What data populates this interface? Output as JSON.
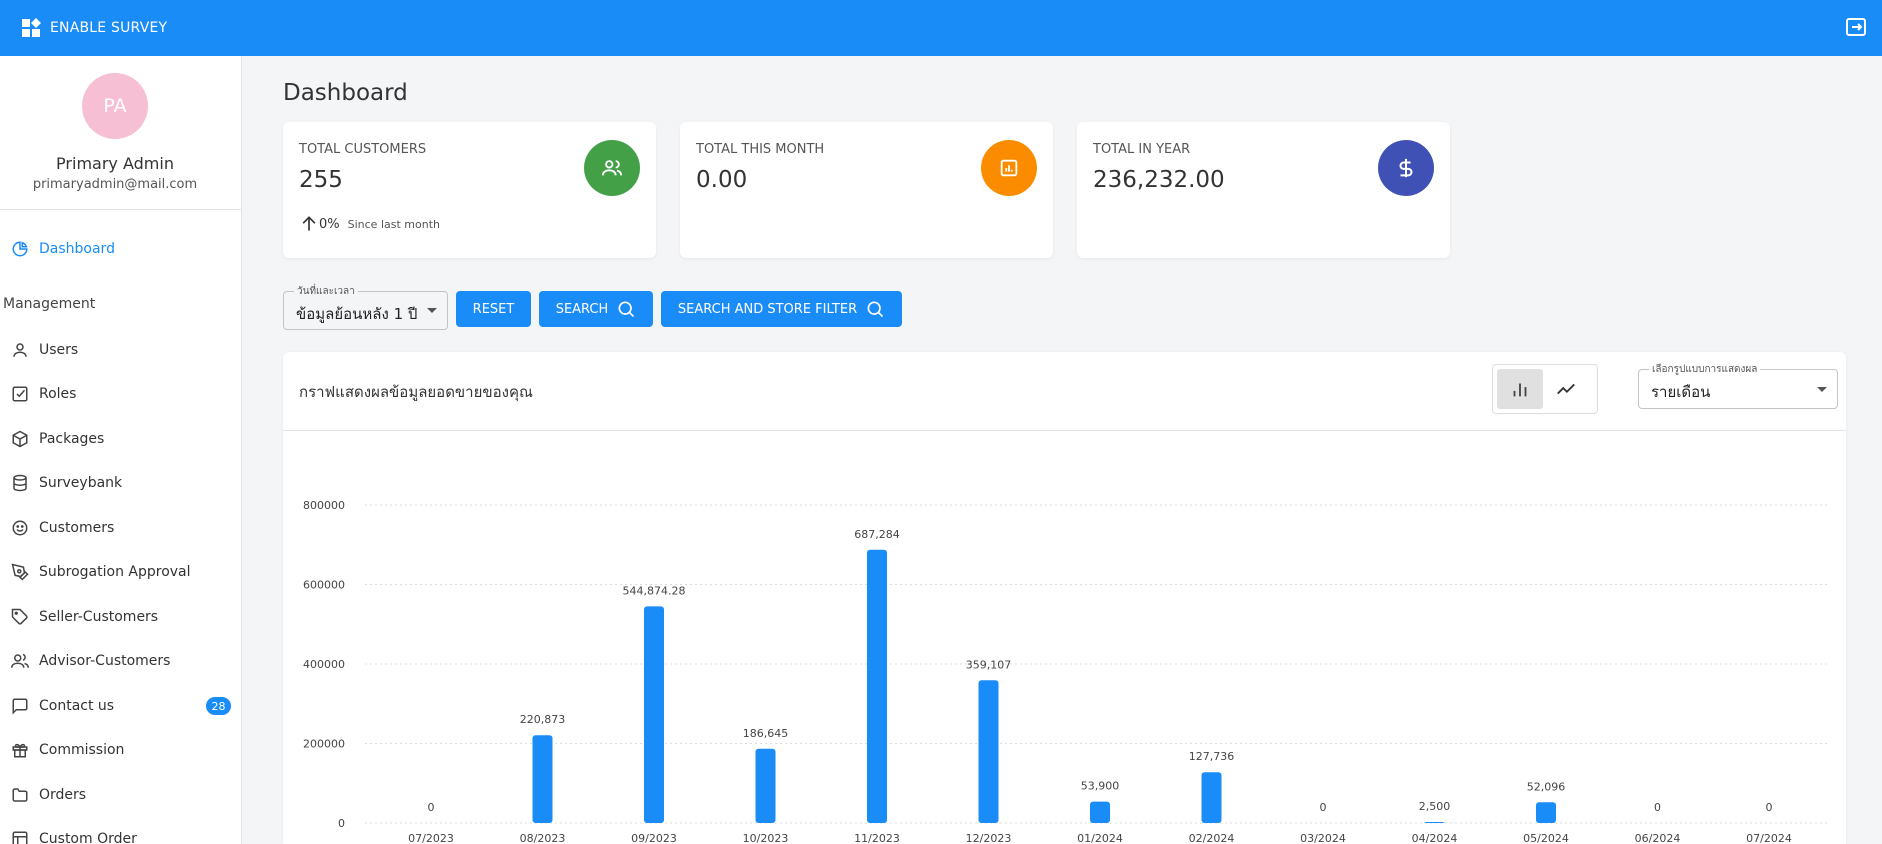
{
  "app": {
    "title": "ENABLE SURVEY"
  },
  "user": {
    "initials": "PA",
    "name": "Primary Admin",
    "email": "primaryadmin@mail.com"
  },
  "sidebar": {
    "dashboard_label": "Dashboard",
    "section_label": "Management",
    "items": [
      {
        "label": "Users",
        "icon": "user-icon"
      },
      {
        "label": "Roles",
        "icon": "checkbox-icon"
      },
      {
        "label": "Packages",
        "icon": "package-icon"
      },
      {
        "label": "Surveybank",
        "icon": "database-icon"
      },
      {
        "label": "Customers",
        "icon": "smile-icon"
      },
      {
        "label": "Subrogation Approval",
        "icon": "pen-icon"
      },
      {
        "label": "Seller-Customers",
        "icon": "tag-icon"
      },
      {
        "label": "Advisor-Customers",
        "icon": "users-icon"
      },
      {
        "label": "Contact us",
        "icon": "message-icon",
        "badge": "28"
      },
      {
        "label": "Commission",
        "icon": "gift-icon"
      },
      {
        "label": "Orders",
        "icon": "folder-icon"
      },
      {
        "label": "Custom Order",
        "icon": "table-icon"
      }
    ]
  },
  "page": {
    "title": "Dashboard"
  },
  "cards": {
    "customers": {
      "label": "TOTAL CUSTOMERS",
      "value": "255",
      "trend_value": "0%",
      "trend_text": "Since last month",
      "color": "#43a047"
    },
    "month": {
      "label": "TOTAL THIS MONTH",
      "value": "0.00",
      "color": "#fb8c00"
    },
    "year": {
      "label": "TOTAL IN YEAR",
      "value": "236,232.00",
      "color": "#3f51b5"
    }
  },
  "filters": {
    "date_legend": "วันที่และเวลา",
    "date_value": "ข้อมูลย้อนหลัง 1 ปี",
    "reset_label": "RESET",
    "search_label": "SEARCH",
    "search_store_label": "SEARCH AND STORE FILTER"
  },
  "chart_panel": {
    "title": "กราฟแสดงผลข้อมูลยอดขายของคุณ",
    "mode_legend": "เลือกรูปแบบการแสดงผล",
    "mode_value": "รายเดือน"
  },
  "colors": {
    "accent": "#1a8cf7"
  },
  "chart_data": {
    "type": "bar",
    "categories": [
      "07/2023",
      "08/2023",
      "09/2023",
      "10/2023",
      "11/2023",
      "12/2023",
      "01/2024",
      "02/2024",
      "03/2024",
      "04/2024",
      "05/2024",
      "06/2024",
      "07/2024"
    ],
    "values": [
      0,
      220873,
      544874.28,
      186645,
      687284,
      359107,
      53900,
      127736,
      0,
      2500,
      52096,
      0,
      0
    ],
    "labels": [
      "0",
      "220,873",
      "544,874.28",
      "186,645",
      "687,284",
      "359,107",
      "53,900",
      "127,736",
      "0",
      "2,500",
      "52,096",
      "0",
      "0"
    ],
    "yticks": [
      "0",
      "200000",
      "400000",
      "600000",
      "800000"
    ],
    "ylim": [
      0,
      800000
    ],
    "grid": true,
    "color": "#1a8cf7"
  }
}
